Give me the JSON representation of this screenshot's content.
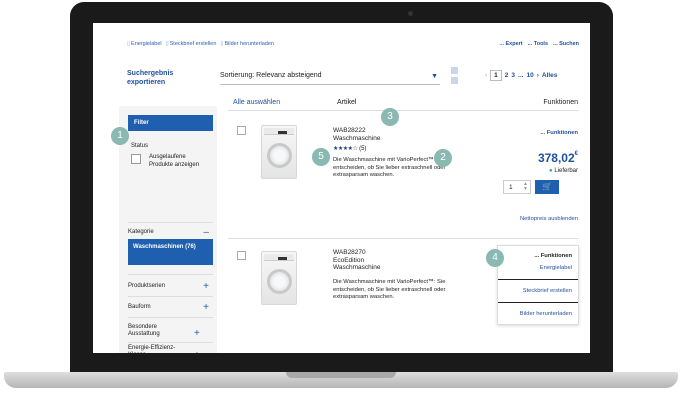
{
  "toplinks": [
    "Energielabel",
    "Steckbrief erstellen",
    "Bilder herunterladen"
  ],
  "toolbar": {
    "expert": "... Expert",
    "tools": "... Tools",
    "search": "... Suchen"
  },
  "export": {
    "label": "Suchergebnis exportieren"
  },
  "sort": {
    "label": "Sortierung: Relevanz absteigend"
  },
  "pagination": {
    "prev": "‹",
    "current": "1",
    "p2": "2",
    "p3": "3",
    "dots": "...",
    "p10": "10",
    "next": "›",
    "all": "Alles"
  },
  "table_header": {
    "select_all": "Alle auswählen",
    "article": "Artikel",
    "functions": "Funktionen"
  },
  "sidebar": {
    "filter": "Filter",
    "status": "Status",
    "discontinued": "Ausgelaufene Produkte anzeigen",
    "category": "Kategorie",
    "category_sign": "–",
    "active_category": "Waschmaschinen (76)",
    "sections": [
      {
        "label": "Produktserien",
        "sign": "+"
      },
      {
        "label": "Bauform",
        "sign": "+"
      },
      {
        "label": "Besondere Ausstattung",
        "sign": "+"
      },
      {
        "label": "Energie-Effizienz-Klasse",
        "sign": "+"
      }
    ]
  },
  "products": [
    {
      "code": "WAB28222",
      "name": "Waschmaschine",
      "stars": "★★★★☆",
      "reviews": "(5)",
      "description": "Die Waschmaschine mit VarioPerfect™: Sie entscheiden, ob Sie lieber extraschnell oder extrasparsam waschen.",
      "functions_link": "... Funktionen",
      "price": "378,02",
      "currency": "€",
      "stock": "Lieferbar",
      "quantity": "1",
      "hide_price": "Nettopreis ausblenden"
    },
    {
      "code": "WAB28270",
      "edition": "EcoEdition",
      "name": "Waschmaschine",
      "description": "Die Waschmaschine mit VarioPerfect™: Sie entscheiden, ob Sie lieber extraschnell oder extrasparsam waschen."
    }
  ],
  "functions_menu": {
    "header": "... Funktionen",
    "items": [
      "Energielabel",
      "Steckbrief erstellen",
      "Bilder herunterladen"
    ]
  },
  "markers": [
    "1",
    "2",
    "3",
    "4",
    "5"
  ],
  "colors": {
    "brand_blue": "#1f5fb0",
    "marker": "#8ab8b3",
    "stock_green": "#2db24a"
  }
}
